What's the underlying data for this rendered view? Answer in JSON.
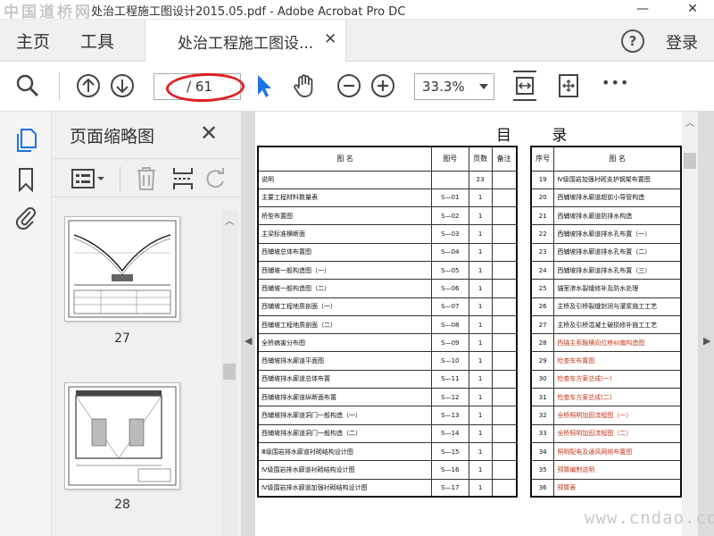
{
  "titlebar": {
    "watermark": "中国道桥网",
    "title": "处治工程施工图设计2015.05.pdf - Adobe Acrobat Pro DC",
    "minimize": "—",
    "close": "✕"
  },
  "menubar": {
    "home": "主页",
    "tools": "工具",
    "tab_label": "处治工程施工图设...",
    "tab_close": "✕",
    "help": "?",
    "login": "登录"
  },
  "toolbar": {
    "page_current": "",
    "page_total": "/ 61",
    "zoom": "33.3%",
    "more": "•••"
  },
  "thumbnails": {
    "title": "页面缩略图",
    "close": "✕",
    "pages": [
      "27",
      "28"
    ]
  },
  "document": {
    "title": "目 录",
    "left_header": [
      "图 名",
      "图号",
      "页数",
      "备注"
    ],
    "left_rows": [
      [
        "说明",
        "",
        "23",
        ""
      ],
      [
        "主要工程材料数量表",
        "S—01",
        "1",
        ""
      ],
      [
        "桥型布置图",
        "S—02",
        "1",
        ""
      ],
      [
        "主梁标准横断面",
        "S—03",
        "1",
        ""
      ],
      [
        "西辅坡总体布置图",
        "S—04",
        "1",
        ""
      ],
      [
        "西辅坡一般构造图（一）",
        "S—05",
        "1",
        ""
      ],
      [
        "西辅坡一般构造图（二）",
        "S—06",
        "1",
        ""
      ],
      [
        "西辅坡工程地质剖面（一）",
        "S—07",
        "1",
        ""
      ],
      [
        "西辅坡工程地质剖面（二）",
        "S—08",
        "1",
        ""
      ],
      [
        "全桥病害分布图",
        "S—09",
        "1",
        ""
      ],
      [
        "西辅坡排水廊道平面图",
        "S—10",
        "1",
        ""
      ],
      [
        "西辅坡排水廊道总体布置",
        "S—11",
        "1",
        ""
      ],
      [
        "西辅坡排水廊道纵断面布置",
        "S—12",
        "1",
        ""
      ],
      [
        "西辅坡排水廊道洞门一般构造（一）",
        "S—13",
        "1",
        ""
      ],
      [
        "西辅坡排水廊道洞门一般构造（二）",
        "S—14",
        "1",
        ""
      ],
      [
        "Ⅲ级围岩排水廊道衬砌结构设计图",
        "S—15",
        "1",
        ""
      ],
      [
        "Ⅳ级围岩排水廊道衬砌结构设计图",
        "S—16",
        "1",
        ""
      ],
      [
        "Ⅳ级围岩排水廊道加强衬砌结构设计图",
        "S—17",
        "1",
        ""
      ]
    ],
    "right_header": [
      "序号",
      "图 名"
    ],
    "right_rows": [
      [
        "19",
        "Ⅳ级围岩加强衬砌支护钢架布置图"
      ],
      [
        "20",
        "西辅坡排水廊道超前小导管构造"
      ],
      [
        "21",
        "西辅坡排水廊道防排水构造"
      ],
      [
        "22",
        "西辅坡排水廊道排水孔布置（一）"
      ],
      [
        "23",
        "西辅坡排水廊道排水孔布置（二）"
      ],
      [
        "24",
        "西辅坡排水廊道排水孔布置（三）"
      ],
      [
        "25",
        "锚室渗水裂缝修补及防水处理"
      ],
      [
        "26",
        "主桥及引桥裂缝封闭与灌浆施工工艺"
      ],
      [
        "27",
        "主桥及引桥混凝土破损修补施工工艺"
      ],
      [
        "28",
        "西锚主索鞍横向位移纠偏构造图"
      ],
      [
        "29",
        "检查车布置图"
      ],
      [
        "30",
        "检查车方案总成(一)"
      ],
      [
        "31",
        "检查车方案总成(二)"
      ],
      [
        "32",
        "全桥照明加固流程图（一）"
      ],
      [
        "33",
        "全桥照明加固流程图（二）"
      ],
      [
        "34",
        "照明配电及通风网络布置图"
      ],
      [
        "35",
        "预算编制说明"
      ],
      [
        "36",
        "预算表"
      ]
    ]
  },
  "footer_watermark": "www.cndao.com",
  "colors": {
    "accent_blue": "#1a73e8",
    "highlight_red": "#e02020"
  }
}
